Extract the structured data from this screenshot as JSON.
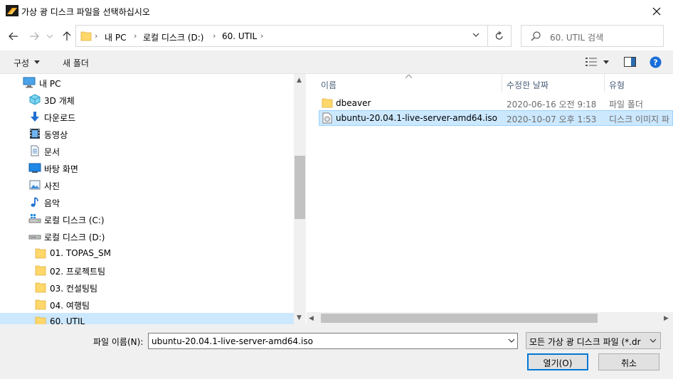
{
  "window": {
    "title": "가상 광 디스크 파일을 선택하십시오"
  },
  "address": {
    "crumbs": [
      "내 PC",
      "로컬 디스크 (D:)",
      "60. UTIL"
    ]
  },
  "search": {
    "placeholder": "60. UTIL 검색"
  },
  "toolbar": {
    "organize": "구성",
    "new_folder": "새 폴더"
  },
  "nav_tree": [
    {
      "label": "내 PC",
      "icon": "pc-icon"
    },
    {
      "label": "3D 개체",
      "icon": "3d-object-icon"
    },
    {
      "label": "다운로드",
      "icon": "download-icon"
    },
    {
      "label": "동영상",
      "icon": "video-icon"
    },
    {
      "label": "문서",
      "icon": "document-icon"
    },
    {
      "label": "바탕 화면",
      "icon": "desktop-icon"
    },
    {
      "label": "사진",
      "icon": "picture-icon"
    },
    {
      "label": "음악",
      "icon": "music-icon"
    },
    {
      "label": "로컬 디스크 (C:)",
      "icon": "drive-c-icon"
    },
    {
      "label": "로컬 디스크 (D:)",
      "icon": "drive-d-icon"
    },
    {
      "label": "01. TOPAS_SM",
      "icon": "folder-icon"
    },
    {
      "label": "02. 프로젝트팀",
      "icon": "folder-icon"
    },
    {
      "label": "03. 컨설팅팀",
      "icon": "folder-icon"
    },
    {
      "label": "04. 여행팀",
      "icon": "folder-icon"
    },
    {
      "label": "60. UTIL",
      "icon": "folder-icon"
    }
  ],
  "columns": {
    "name": "이름",
    "date": "수정한 날짜",
    "type": "유형"
  },
  "files": [
    {
      "name": "dbeaver",
      "date": "2020-06-16 오전 9:18",
      "type": "파일 폴더",
      "icon": "folder-icon"
    },
    {
      "name": "ubuntu-20.04.1-live-server-amd64.iso",
      "date": "2020-10-07 오후 1:53",
      "type": "디스크 이미지 파",
      "icon": "disc-image-icon"
    }
  ],
  "bottom": {
    "filename_label": "파일 이름(N):",
    "filename_value": "ubuntu-20.04.1-live-server-amd64.iso",
    "filetype_value": "모든 가상 광 디스크 파일 (*.dr",
    "open_label": "열기(O)",
    "cancel_label": "취소"
  },
  "colors": {
    "selection": "#cce8ff",
    "accent": "#0078d7",
    "folder": "#ffd76a"
  }
}
